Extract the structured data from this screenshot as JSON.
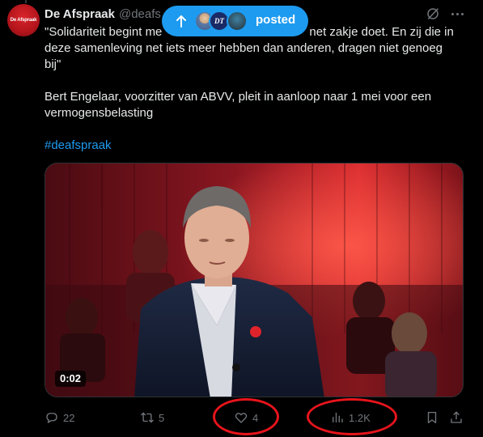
{
  "tweet": {
    "display_name": "De Afspraak",
    "handle": "@deafs",
    "avatar_text": "De Afspraak",
    "text_lines": [
      "\"Solidariteit begint me",
      "net zakje doet. En zij die in",
      "deze samenleving net iets meer hebben dan anderen, dragen niet genoeg",
      "bij\""
    ],
    "line1_hidden_part": "",
    "paragraph2": "Bert Engelaar, voorzitter van ABVV, pleit in aanloop naar 1 mei voor een vermogensbelasting",
    "hashtag": "#deafspraak"
  },
  "posted_pill": {
    "label": "posted",
    "arrow_icon": "arrow-up-icon",
    "color": "#1d9bf0"
  },
  "media": {
    "duration": "0:02"
  },
  "actions": {
    "reply_count": "22",
    "retweet_count": "5",
    "like_count": "4",
    "views_count": "1.2K"
  },
  "colors": {
    "background": "#000000",
    "text": "#e7e9ea",
    "muted": "#71767b",
    "link": "#1d9bf0",
    "annotation_ring": "#e8141c"
  },
  "icons": [
    "grok-icon",
    "more-icon",
    "reply-icon",
    "retweet-icon",
    "heart-icon",
    "views-icon",
    "bookmark-icon",
    "share-icon"
  ]
}
